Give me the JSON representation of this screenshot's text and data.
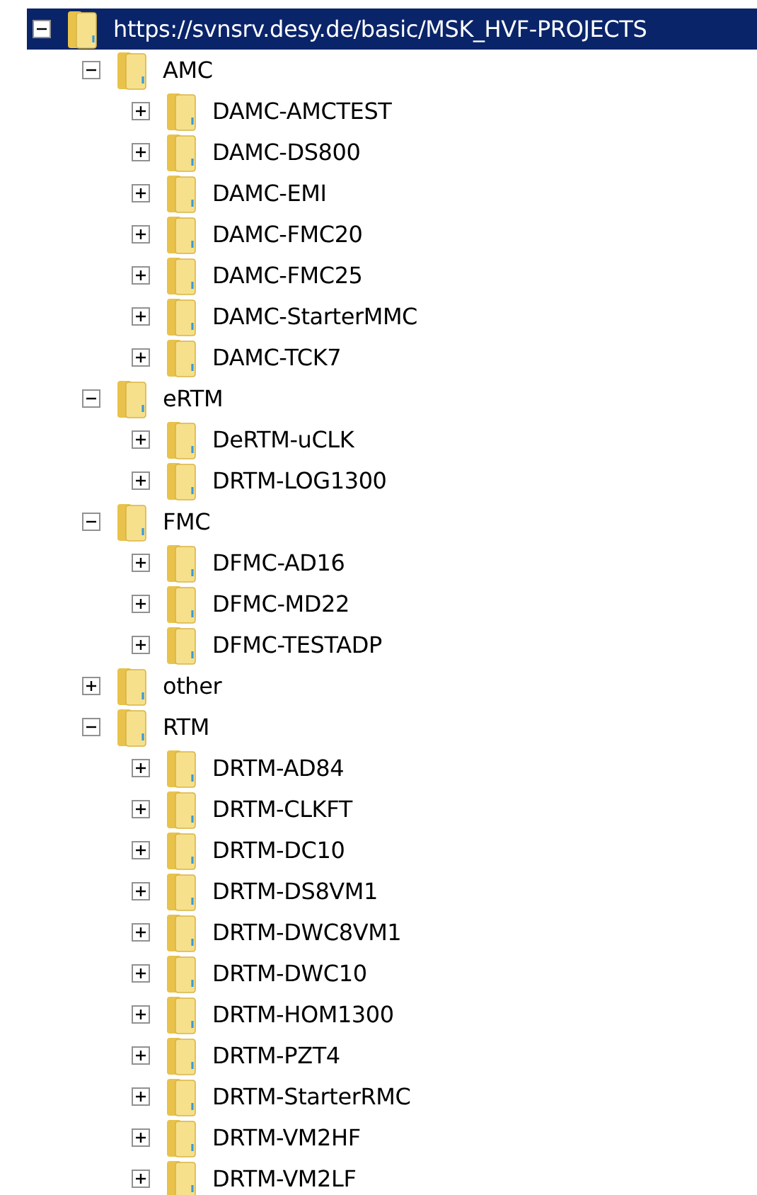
{
  "tree": [
    {
      "label": "https://svnsrv.desy.de/basic/MSK_HVF-PROJECTS",
      "expanded": true,
      "selected": true,
      "children": [
        {
          "label": "AMC",
          "expanded": true,
          "selected": false,
          "children": [
            {
              "label": "DAMC-AMCTEST",
              "expanded": false,
              "selected": false
            },
            {
              "label": "DAMC-DS800",
              "expanded": false,
              "selected": false
            },
            {
              "label": "DAMC-EMI",
              "expanded": false,
              "selected": false
            },
            {
              "label": "DAMC-FMC20",
              "expanded": false,
              "selected": false
            },
            {
              "label": "DAMC-FMC25",
              "expanded": false,
              "selected": false
            },
            {
              "label": "DAMC-StarterMMC",
              "expanded": false,
              "selected": false
            },
            {
              "label": "DAMC-TCK7",
              "expanded": false,
              "selected": false
            }
          ]
        },
        {
          "label": "eRTM",
          "expanded": true,
          "selected": false,
          "children": [
            {
              "label": "DeRTM-uCLK",
              "expanded": false,
              "selected": false
            },
            {
              "label": "DRTM-LOG1300",
              "expanded": false,
              "selected": false
            }
          ]
        },
        {
          "label": "FMC",
          "expanded": true,
          "selected": false,
          "children": [
            {
              "label": "DFMC-AD16",
              "expanded": false,
              "selected": false
            },
            {
              "label": "DFMC-MD22",
              "expanded": false,
              "selected": false
            },
            {
              "label": "DFMC-TESTADP",
              "expanded": false,
              "selected": false
            }
          ]
        },
        {
          "label": "other",
          "expanded": false,
          "selected": false
        },
        {
          "label": "RTM",
          "expanded": true,
          "selected": false,
          "children": [
            {
              "label": "DRTM-AD84",
              "expanded": false,
              "selected": false
            },
            {
              "label": "DRTM-CLKFT",
              "expanded": false,
              "selected": false
            },
            {
              "label": "DRTM-DC10",
              "expanded": false,
              "selected": false
            },
            {
              "label": "DRTM-DS8VM1",
              "expanded": false,
              "selected": false
            },
            {
              "label": "DRTM-DWC8VM1",
              "expanded": false,
              "selected": false
            },
            {
              "label": "DRTM-DWC10",
              "expanded": false,
              "selected": false
            },
            {
              "label": "DRTM-HOM1300",
              "expanded": false,
              "selected": false
            },
            {
              "label": "DRTM-PZT4",
              "expanded": false,
              "selected": false
            },
            {
              "label": "DRTM-StarterRMC",
              "expanded": false,
              "selected": false
            },
            {
              "label": "DRTM-VM2HF",
              "expanded": false,
              "selected": false
            },
            {
              "label": "DRTM-VM2LF",
              "expanded": false,
              "selected": false
            }
          ]
        }
      ]
    }
  ]
}
